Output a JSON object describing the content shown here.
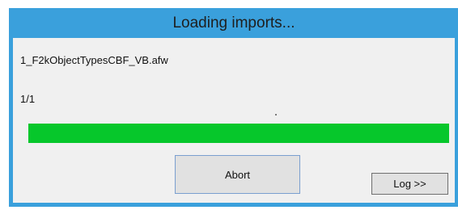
{
  "dialog": {
    "title": "Loading imports...",
    "file_name": "1_F2kObjectTypesCBF_VB.afw",
    "count": "1/1",
    "progress": 1.0,
    "abort_label": "Abort",
    "log_label": "Log >>"
  },
  "colors": {
    "frame": "#3aa0dc",
    "progress_fill": "#06c72b",
    "client_bg": "#f0f0f0"
  }
}
